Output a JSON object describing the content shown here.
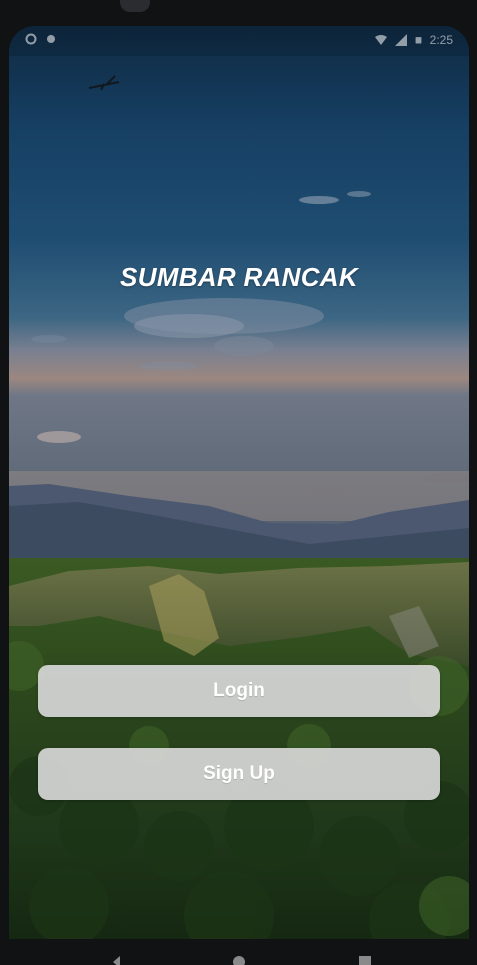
{
  "status_bar": {
    "time": "2:25",
    "left_icons": [
      "settings-icon",
      "notification-icon"
    ],
    "right_icons": [
      "wifi-icon",
      "signal-icon",
      "battery-icon"
    ]
  },
  "app": {
    "title": "SUMBAR RANCAK"
  },
  "buttons": {
    "login": "Login",
    "signup": "Sign Up"
  },
  "navigation": {
    "buttons": [
      "back-icon",
      "home-icon",
      "recents-icon"
    ]
  },
  "colors": {
    "sky_top": "#163f63",
    "sky_mid": "#27577a",
    "horizon": "#8e7c79",
    "forest": "#2e4a1d",
    "button_bg": "#d7d7d7",
    "button_text": "#ffffff"
  }
}
